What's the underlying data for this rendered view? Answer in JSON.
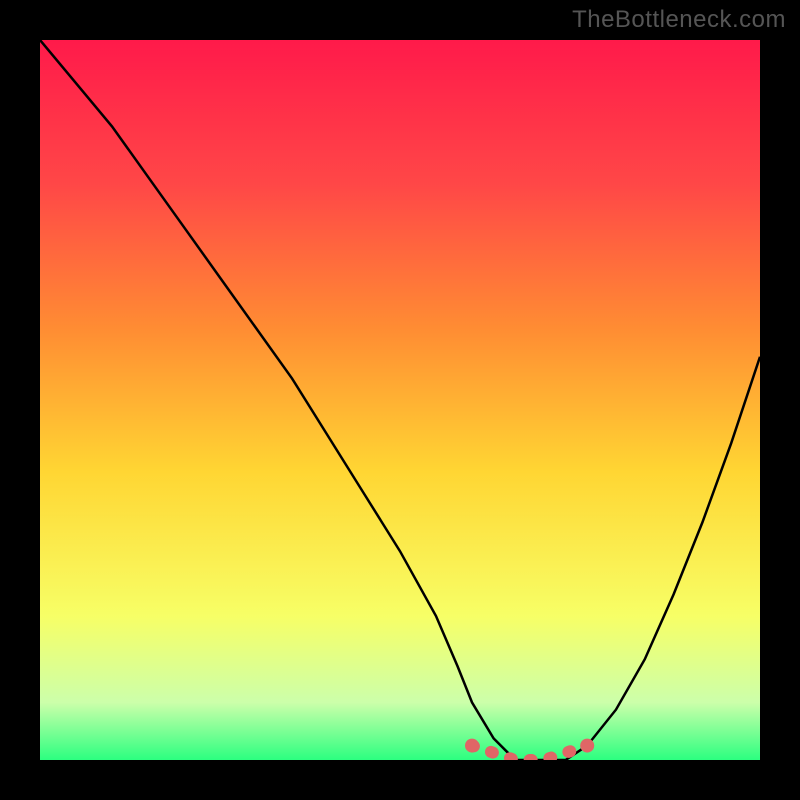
{
  "watermark": "TheBottleneck.com",
  "chart_data": {
    "type": "line",
    "title": "",
    "xlabel": "",
    "ylabel": "",
    "xlim": [
      0,
      100
    ],
    "ylim": [
      0,
      100
    ],
    "background_gradient": {
      "stops": [
        {
          "offset": 0.0,
          "color": "#ff1a4a"
        },
        {
          "offset": 0.2,
          "color": "#ff4747"
        },
        {
          "offset": 0.4,
          "color": "#ff8c33"
        },
        {
          "offset": 0.6,
          "color": "#ffd633"
        },
        {
          "offset": 0.8,
          "color": "#f7ff66"
        },
        {
          "offset": 0.92,
          "color": "#ccffaa"
        },
        {
          "offset": 1.0,
          "color": "#2cff80"
        }
      ]
    },
    "series": [
      {
        "name": "bottleneck-curve",
        "color": "#000000",
        "x": [
          0,
          5,
          10,
          15,
          20,
          25,
          30,
          35,
          40,
          45,
          50,
          55,
          58,
          60,
          63,
          66,
          70,
          73,
          76,
          80,
          84,
          88,
          92,
          96,
          100
        ],
        "y": [
          100,
          94,
          88,
          81,
          74,
          67,
          60,
          53,
          45,
          37,
          29,
          20,
          13,
          8,
          3,
          0,
          0,
          0,
          2,
          7,
          14,
          23,
          33,
          44,
          56
        ]
      }
    ],
    "highlight": {
      "name": "optimal-zone",
      "color": "#e06666",
      "x": [
        60,
        63,
        66,
        70,
        73,
        76
      ],
      "y": [
        2,
        1,
        0,
        0,
        1,
        2
      ]
    }
  }
}
